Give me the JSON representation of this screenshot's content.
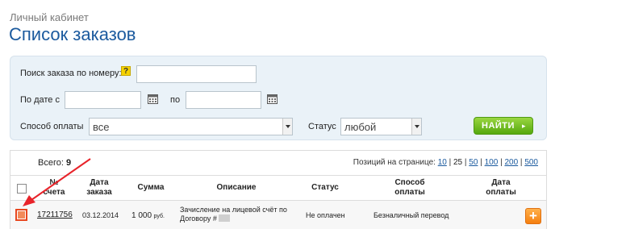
{
  "breadcrumb": "Личный кабинет",
  "title": "Список заказов",
  "filters": {
    "search_label": "Поиск заказа по номеру:",
    "help_label": "?",
    "date_from_label": "По дате с",
    "date_to_label": "по",
    "payment_label": "Способ оплаты",
    "payment_value": "все",
    "status_label": "Статус",
    "status_value": "любой",
    "find_button": "НАЙТИ",
    "find_arrow": "▸"
  },
  "summary": {
    "total_label": "Всего:",
    "total_value": "9",
    "per_page_label": "Позиций на странице:",
    "per_page_options": [
      "10",
      "25",
      "50",
      "100",
      "200",
      "500"
    ],
    "separators": [
      "|",
      "|",
      "|",
      "|",
      "|"
    ]
  },
  "table": {
    "headers": {
      "number": "№ счета",
      "date": "Дата заказа",
      "sum": "Сумма",
      "description": "Описание",
      "status": "Статус",
      "payment": "Способ оплаты",
      "paid_date": "Дата оплаты"
    },
    "rows": [
      {
        "number": "17211756",
        "date": "03.12.2014",
        "sum": "1 000",
        "currency": "руб.",
        "description_line1": "Зачисление на лицевой счёт по",
        "description_line2": "Договору #",
        "status": "Не оплачен",
        "payment": "Безналичный перевод",
        "plus": "+"
      }
    ]
  },
  "colors": {
    "title": "#1b5a9e",
    "panel": "#eaf2f8",
    "find_button": "#55a80e",
    "plus_button": "#f57f10",
    "annotation_arrow": "#e8232a"
  }
}
